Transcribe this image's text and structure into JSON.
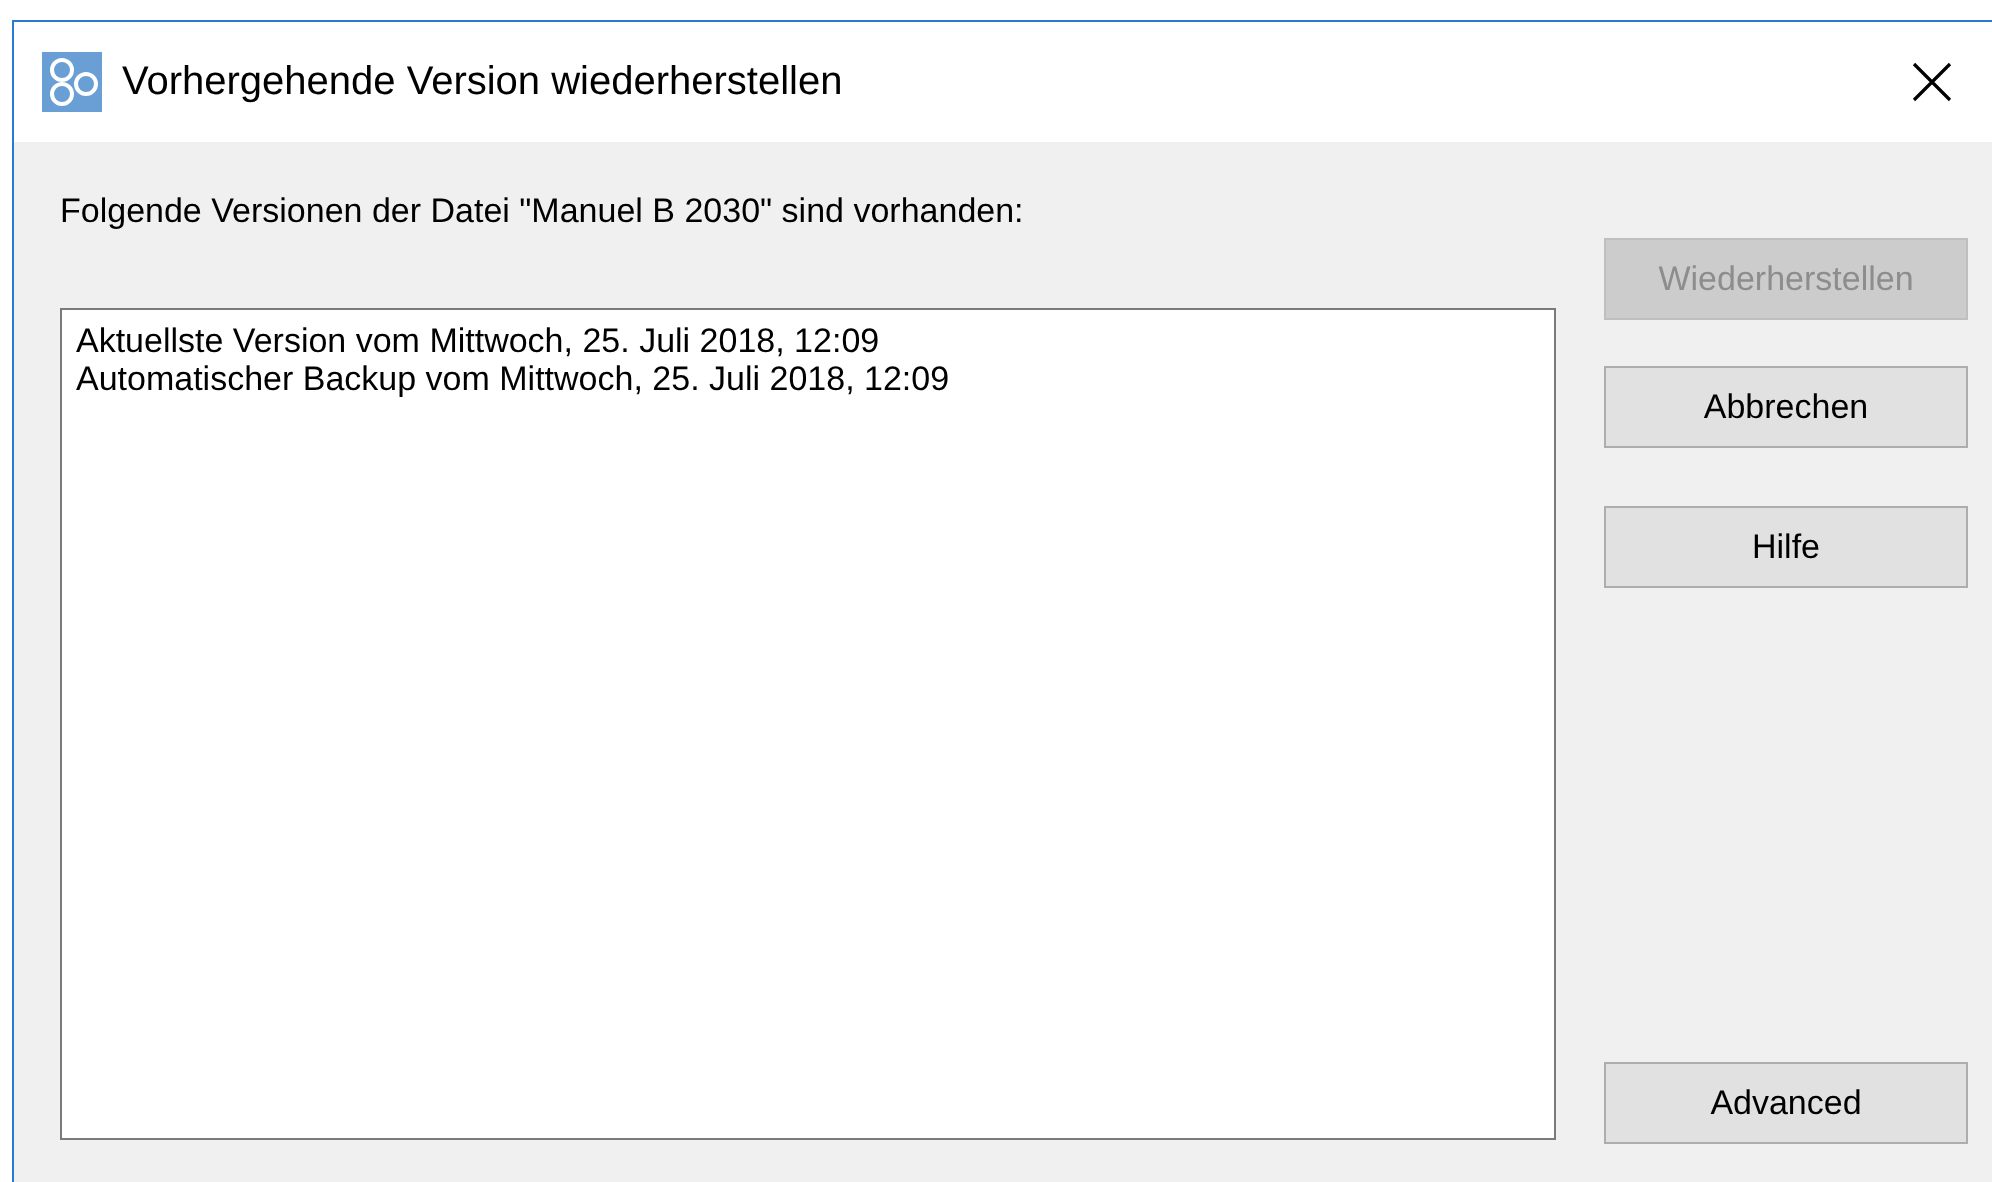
{
  "window": {
    "title": "Vorhergehende Version wiederherstellen"
  },
  "prompt": "Folgende Versionen der Datei \"Manuel B 2030\" sind vorhanden:",
  "versions": [
    "Aktuellste Version vom Mittwoch, 25. Juli 2018, 12:09",
    "Automatischer Backup vom Mittwoch, 25. Juli 2018, 12:09"
  ],
  "buttons": [
    {
      "label": "Wiederherstellen",
      "disabled": true
    },
    {
      "label": "Abbrechen",
      "disabled": false
    },
    {
      "label": "Hilfe",
      "disabled": false
    },
    {
      "label": "Advanced",
      "disabled": false
    }
  ]
}
